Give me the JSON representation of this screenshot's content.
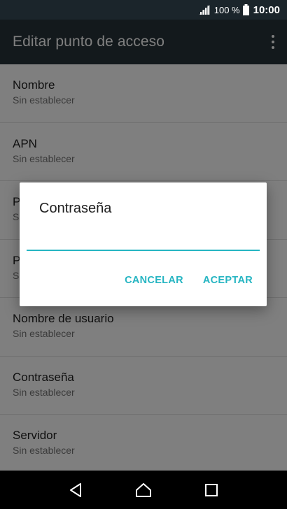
{
  "status_bar": {
    "battery_percent": "100 %",
    "time": "10:00",
    "icons": [
      "signal-icon",
      "battery-icon"
    ]
  },
  "toolbar": {
    "title": "Editar punto de acceso",
    "overflow_icon": "more-vert-icon"
  },
  "list": {
    "items": [
      {
        "title": "Nombre",
        "summary": "Sin establecer"
      },
      {
        "title": "APN",
        "summary": "Sin establecer"
      },
      {
        "title": "P",
        "summary": "S"
      },
      {
        "title": "P",
        "summary": "S"
      },
      {
        "title": "Nombre de usuario",
        "summary": "Sin establecer"
      },
      {
        "title": "Contraseña",
        "summary": "Sin establecer"
      },
      {
        "title": "Servidor",
        "summary": "Sin establecer"
      }
    ]
  },
  "dialog": {
    "title": "Contraseña",
    "input_value": "",
    "cancel_label": "CANCELAR",
    "accept_label": "ACEPTAR",
    "accent_color": "#26b5c2"
  },
  "nav_bar": {
    "icons": [
      "back-icon",
      "home-icon",
      "recents-icon"
    ]
  }
}
